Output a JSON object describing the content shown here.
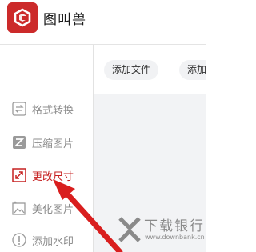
{
  "app": {
    "title": "图叫兽"
  },
  "sidebar": {
    "items": [
      {
        "label": "格式转换",
        "icon": "format-convert-icon",
        "active": false
      },
      {
        "label": "压缩图片",
        "icon": "compress-icon",
        "active": false
      },
      {
        "label": "更改尺寸",
        "icon": "resize-icon",
        "active": true
      },
      {
        "label": "美化图片",
        "icon": "beautify-icon",
        "active": false
      },
      {
        "label": "添加水印",
        "icon": "watermark-icon",
        "active": false
      }
    ]
  },
  "toolbar": {
    "add_file_label": "添加文件",
    "add_folder_label_partial": "添加"
  },
  "watermark": {
    "text": "下载银行",
    "url": "www.downbank.cn"
  },
  "colors": {
    "brand": "#cc2a2a",
    "active": "#c62020",
    "arrow": "#d91e1e"
  }
}
